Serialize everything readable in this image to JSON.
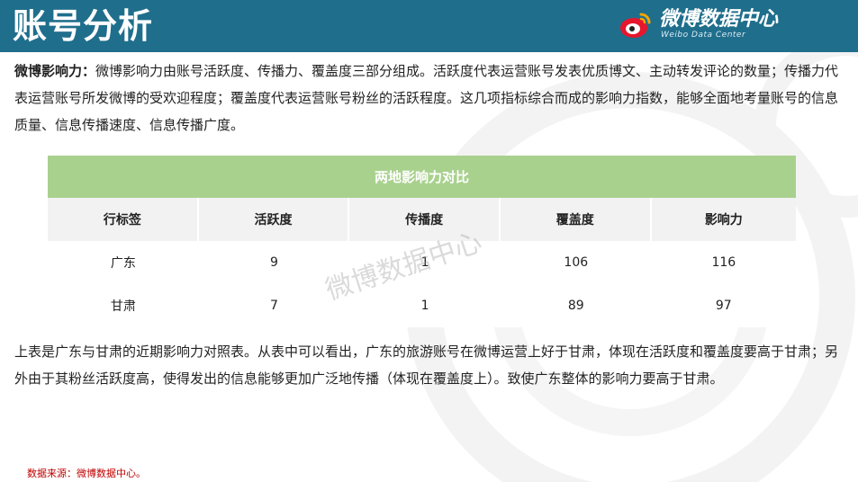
{
  "header": {
    "title": "账号分析"
  },
  "logo": {
    "name": "微博数据中心",
    "subtitle": "Weibo Data Center"
  },
  "intro": {
    "lead": "微博影响力：",
    "text": "微博影响力由账号活跃度、传播力、覆盖度三部分组成。活跃度代表运营账号发表优质博文、主动转发评论的数量；传播力代表运营账号所发微博的受欢迎程度；覆盖度代表运营账号粉丝的活跃程度。这几项指标综合而成的影响力指数，能够全面地考量账号的信息质量、信息传播速度、信息传播广度。"
  },
  "table": {
    "caption": "两地影响力对比",
    "headers": [
      "行标签",
      "活跃度",
      "传播度",
      "覆盖度",
      "影响力"
    ],
    "rows": [
      [
        "广东",
        "9",
        "1",
        "106",
        "116"
      ],
      [
        "甘肃",
        "7",
        "1",
        "89",
        "97"
      ]
    ]
  },
  "watermark": "微博数据中心",
  "summary": "上表是广东与甘肃的近期影响力对照表。从表中可以看出，广东的旅游账号在微博运营上好于甘肃，体现在活跃度和覆盖度要高于甘肃；另外由于其粉丝活跃度高，使得发出的信息能够更加广泛地传播（体现在覆盖度上）。致使广东整体的影响力要高于甘肃。",
  "source": "数据来源：微博数据中心。",
  "colors": {
    "header": "#1f6e8c",
    "table_caption": "#a9d18e",
    "header_row": "#f2f2f2",
    "source_text": "#c00000"
  }
}
